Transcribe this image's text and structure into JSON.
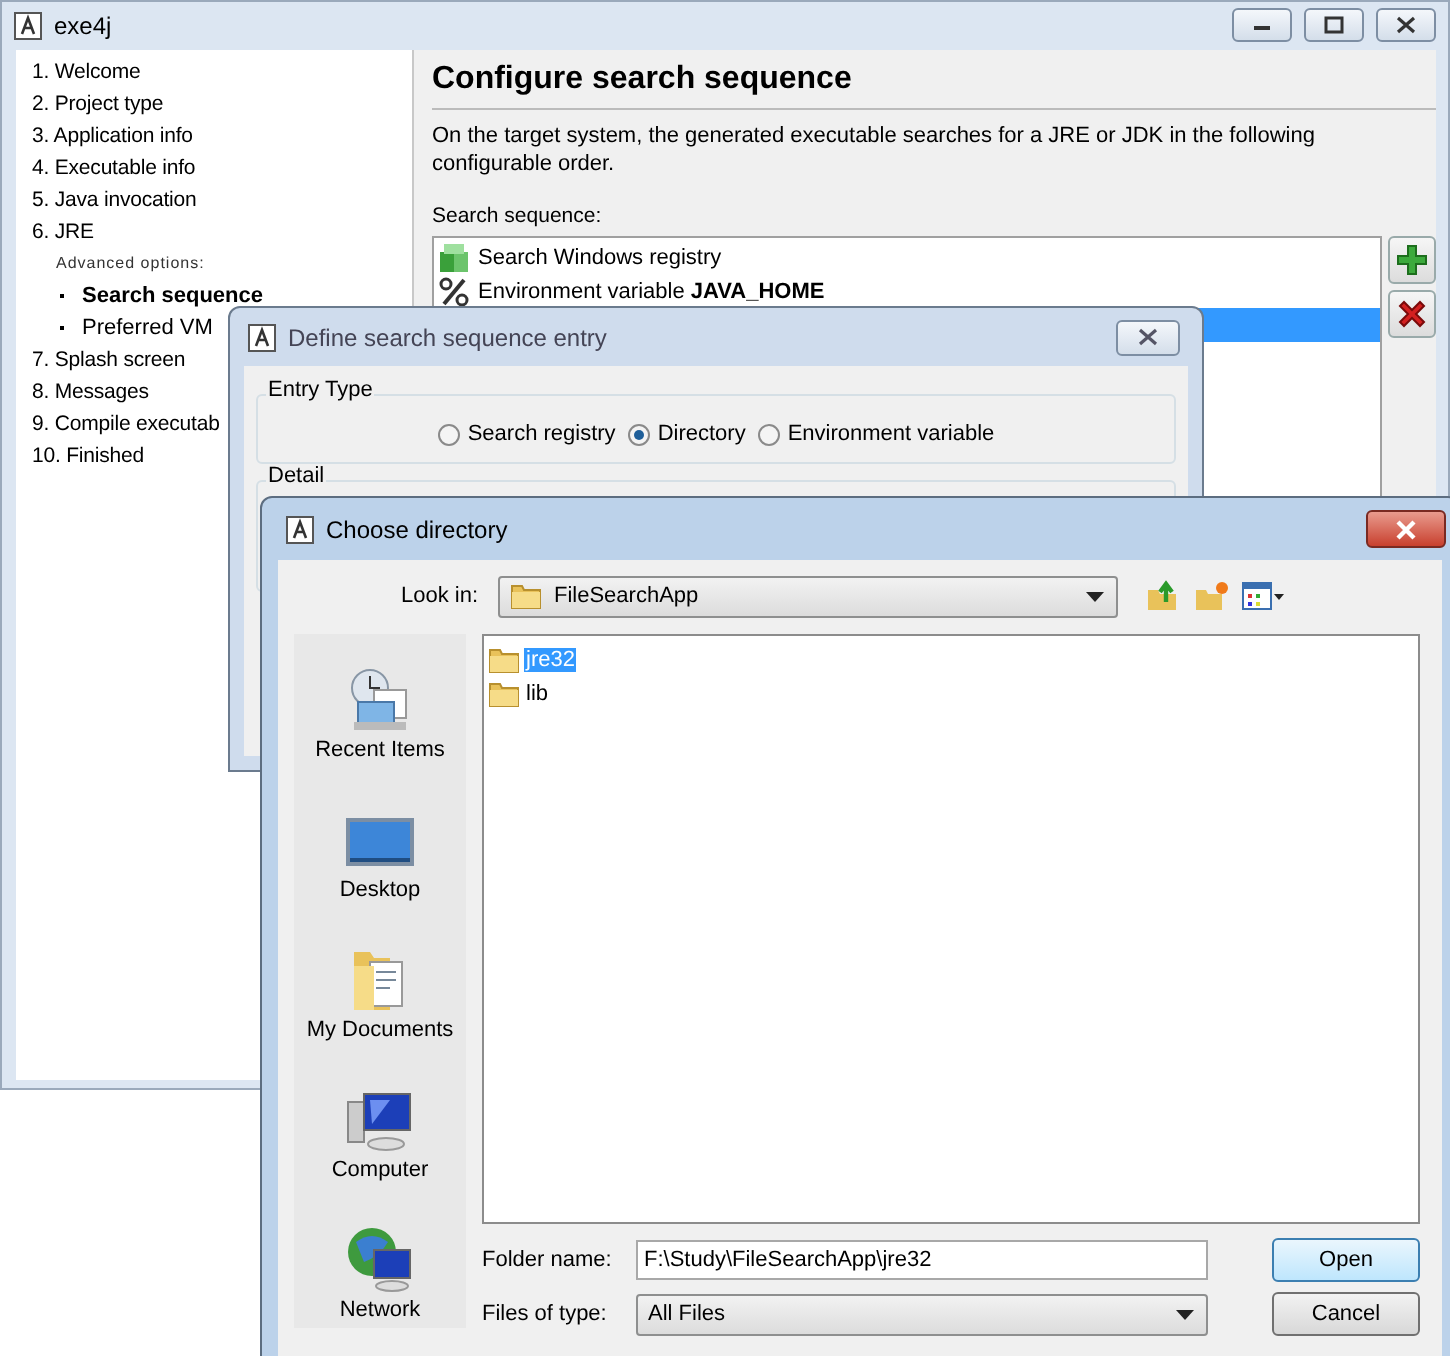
{
  "main_window": {
    "title": "exe4j",
    "nav": [
      {
        "label": "1. Welcome",
        "selected": false
      },
      {
        "label": "2. Project type",
        "selected": false
      },
      {
        "label": "3. Application info",
        "selected": false
      },
      {
        "label": "4. Executable info",
        "selected": false
      },
      {
        "label": "5. Java invocation",
        "selected": false
      },
      {
        "label": "6. JRE",
        "selected": false,
        "subheading": "Advanced options:",
        "children": [
          {
            "label": "Search sequence",
            "selected": true
          },
          {
            "label": "Preferred VM",
            "selected": false
          }
        ]
      },
      {
        "label": "7. Splash screen",
        "selected": false
      },
      {
        "label": "8. Messages",
        "selected": false
      },
      {
        "label": "9. Compile executab",
        "selected": false
      },
      {
        "label": "10. Finished",
        "selected": false
      }
    ],
    "heading": "Configure search sequence",
    "description": "On the target system, the generated executable searches for a JRE or JDK in the following configurable order.",
    "sequence_label": "Search sequence:",
    "sequence": [
      {
        "kind": "registry",
        "label": "Search Windows registry",
        "selected": false
      },
      {
        "kind": "env",
        "label": "Environment variable **JAVA_HOME**",
        "selected": false
      },
      {
        "kind": "hidden",
        "selected": true
      }
    ]
  },
  "define_dialog": {
    "title": "Define search sequence entry",
    "entry_type": {
      "label": "Entry Type",
      "options": [
        {
          "label": "Search registry",
          "selected": false
        },
        {
          "label": "Directory",
          "selected": true
        },
        {
          "label": "Environment variable",
          "selected": false
        }
      ]
    },
    "detail": {
      "label": "Detail"
    }
  },
  "choose_dialog": {
    "title": "Choose directory",
    "look_in": {
      "label": "Look in:",
      "value": "FileSearchApp"
    },
    "places": [
      {
        "kind": "recent",
        "label": "Recent Items"
      },
      {
        "kind": "desktop",
        "label": "Desktop"
      },
      {
        "kind": "documents",
        "label": "My Documents"
      },
      {
        "kind": "computer",
        "label": "Computer"
      },
      {
        "kind": "network",
        "label": "Network"
      }
    ],
    "files": [
      {
        "name": "jre32",
        "selected": true
      },
      {
        "name": "lib",
        "selected": false
      }
    ],
    "folder_name": {
      "label": "Folder name:",
      "value": "F:\\Study\\FileSearchApp\\jre32"
    },
    "files_of_type": {
      "label": "Files of type:",
      "value": "All Files"
    },
    "buttons": [
      {
        "label": "Open",
        "default": true
      },
      {
        "label": "Cancel",
        "default": false
      }
    ]
  }
}
